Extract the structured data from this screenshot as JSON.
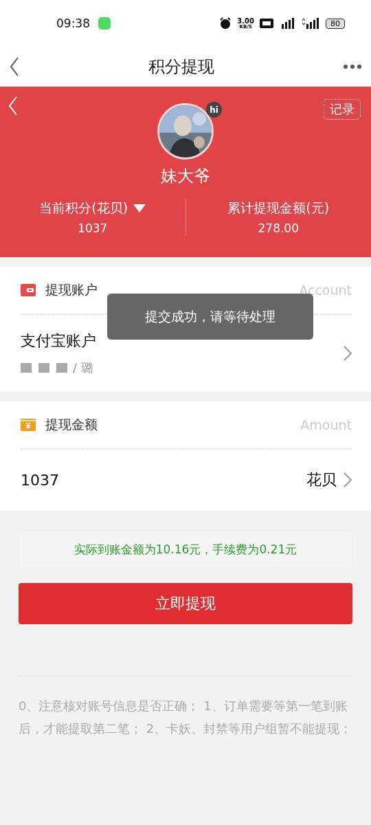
{
  "status_bar": {
    "time": "09:38",
    "speed": "3.00",
    "speed_unit": "KB/S",
    "battery": "80"
  },
  "nav": {
    "title": "积分提现"
  },
  "header": {
    "records": "记录",
    "badge": "hi",
    "username": "妹大爷",
    "stats": [
      {
        "label": "当前积分(花贝)",
        "value": "1037",
        "dropdown": true
      },
      {
        "label": "累计提现金额(元)",
        "value": "278.00",
        "dropdown": false
      }
    ]
  },
  "sections": [
    {
      "kind": "account",
      "title": "提现账户",
      "hint": "Account",
      "value": "支付宝账户",
      "detail": "/ 璐"
    },
    {
      "kind": "amount",
      "title": "提现金额",
      "hint": "Amount",
      "value": "1037",
      "unit": "花贝"
    }
  ],
  "notice": "实际到账金额为10.16元，手续费为0.21元",
  "submit": "立即提现",
  "rules": "0、注意核对账号信息是否正确； 1、订单需要等第一笔到账后，才能提取第二笔； 2、卡妖、封禁等用户组暂不能提现；",
  "toast": "提交成功，请等待处理"
}
